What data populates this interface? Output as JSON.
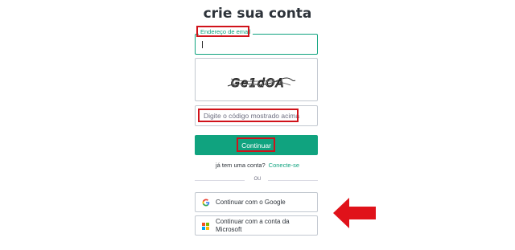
{
  "page": {
    "title": "crie sua conta"
  },
  "email": {
    "label": "Endereço de email",
    "value": ""
  },
  "captcha": {
    "text": "Ge1dOA"
  },
  "code": {
    "placeholder": "Digite o código mostrado acima"
  },
  "continue_button": {
    "label": "Continuar"
  },
  "signin": {
    "prompt": "já tem uma conta?",
    "link": "Conecte-se"
  },
  "divider": {
    "label": "OU"
  },
  "social": {
    "google": {
      "label": "Continuar com o Google",
      "icon": "google-icon"
    },
    "microsoft": {
      "label": "Continuar com a conta da Microsoft",
      "icon": "microsoft-icon"
    }
  },
  "colors": {
    "accent": "#10a37f",
    "highlight": "#d0121a",
    "arrow": "#e0121a",
    "ms_red": "#f25022",
    "ms_green": "#7fba00",
    "ms_blue": "#00a4ef",
    "ms_yellow": "#ffb900"
  }
}
